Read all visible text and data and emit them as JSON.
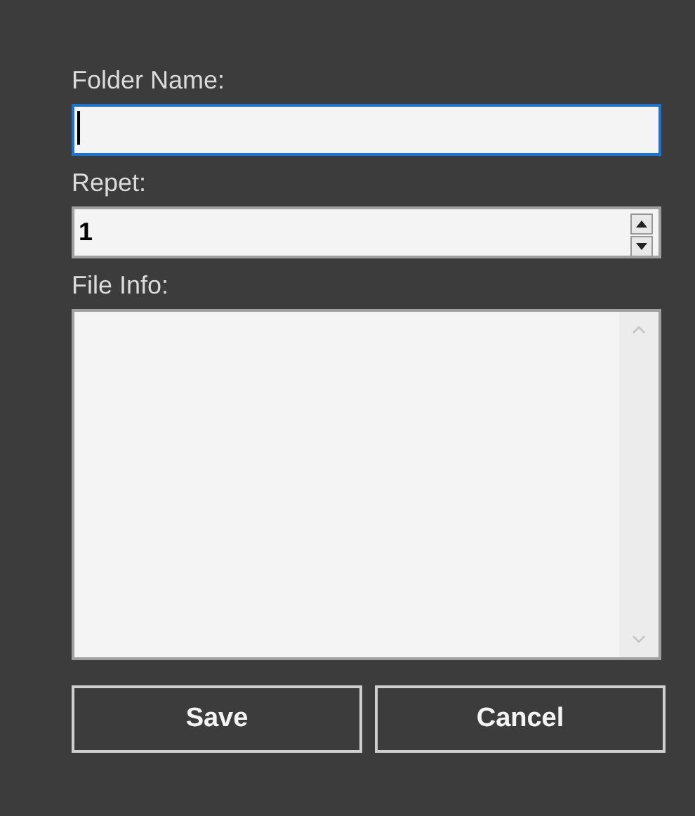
{
  "fields": [
    {
      "kind": "text",
      "label": "Folder Name:",
      "focused": true
    },
    {
      "kind": "number",
      "label": "Repet:",
      "value": "1",
      "focused": false
    },
    {
      "kind": "textarea",
      "label": "File Info:",
      "focused": false
    }
  ],
  "buttons": [
    "Save",
    "Cancel"
  ]
}
